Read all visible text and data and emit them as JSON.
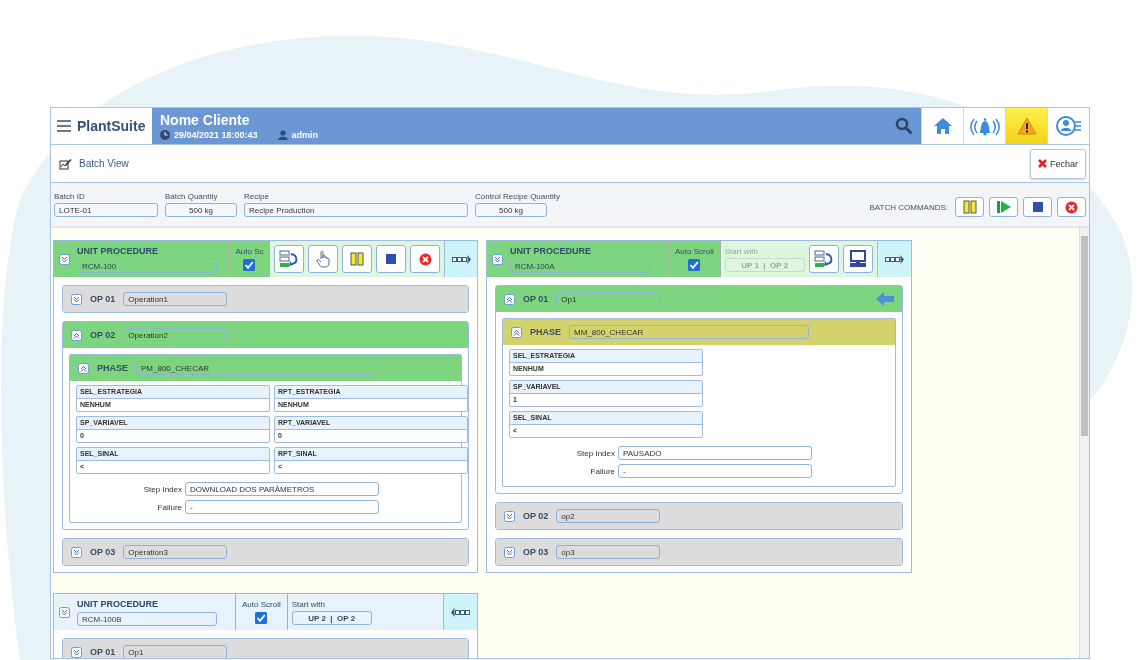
{
  "app": {
    "brand": "PlantSuite",
    "client": "Nome Cliente",
    "datetime": "29/04/2021 18:00:43",
    "user": "admin"
  },
  "header_tiles": [
    {
      "kind": "home",
      "alert": false
    },
    {
      "kind": "alarms",
      "alert": false
    },
    {
      "kind": "warning",
      "alert": true
    },
    {
      "kind": "user-menu",
      "alert": false
    }
  ],
  "page": {
    "title": "Batch View",
    "close_button": "Fechar"
  },
  "batch": {
    "fields": [
      {
        "label": "Batch ID",
        "value": "LOTE-01",
        "kind": "id"
      },
      {
        "label": "Batch Quantity",
        "value": "500 kg",
        "kind": "quantity"
      },
      {
        "label": "Recipe",
        "value": "Recipe Production",
        "kind": "name"
      },
      {
        "label": "Control Recipe Quantity",
        "value": "500 kg",
        "kind": "quantity"
      }
    ],
    "commands_label": "BATCH COMMANDS:",
    "commands": [
      {
        "kind": "pause"
      },
      {
        "kind": "start"
      },
      {
        "kind": "stop"
      },
      {
        "kind": "abort"
      }
    ]
  },
  "units": [
    {
      "active": true,
      "label": "UNIT PROCEDURE",
      "name": "RCM-100",
      "auto_scroll": {
        "label": "Auto Sc",
        "checked": true
      },
      "commands": [
        {
          "kind": "resume"
        },
        {
          "kind": "manual"
        },
        {
          "kind": "pause"
        },
        {
          "kind": "stop"
        },
        {
          "kind": "abort"
        }
      ],
      "nav_back": false,
      "operations": [
        {
          "code": "OP 01",
          "name": "Operation1",
          "active": false,
          "expanded": false,
          "current": false
        },
        {
          "code": "OP 02",
          "name": "Operation2",
          "active": true,
          "expanded": true,
          "current": false,
          "phases": [
            {
              "label": "PHASE",
              "name": "PM_800_CHECAR",
              "paused": false,
              "expanded": true,
              "parameter_rows": [
                [
                  {
                    "name": "SEL_ESTRATEGIA",
                    "value": "NENHUM"
                  },
                  {
                    "name": "RPT_ESTRATEGIA",
                    "value": "NENHUM"
                  }
                ],
                [
                  {
                    "name": "SP_VARIAVEL",
                    "value": "0"
                  },
                  {
                    "name": "RPT_VARIAVEL",
                    "value": "0"
                  }
                ],
                [
                  {
                    "name": "SEL_SINAL",
                    "value": "<"
                  },
                  {
                    "name": "RPT_SINAL",
                    "value": "<"
                  }
                ]
              ],
              "step_index": {
                "label": "Step Index",
                "value": "DOWNLOAD DOS PARÂMETROS"
              },
              "failure": {
                "label": "Failure",
                "value": "-"
              }
            }
          ]
        },
        {
          "code": "OP 03",
          "name": "Operation3",
          "active": false,
          "expanded": false,
          "current": false
        }
      ]
    },
    {
      "active": true,
      "label": "UNIT PROCEDURE",
      "name": "RCM-100A",
      "auto_scroll": {
        "label": "Auto Scroll",
        "checked": true
      },
      "start_with": {
        "label": "Start with",
        "value": "UP 1  |  OP 2",
        "disabled": true
      },
      "commands": [
        {
          "kind": "resume"
        },
        {
          "kind": "computer"
        }
      ],
      "nav_back": false,
      "operations": [
        {
          "code": "OP 01",
          "name": "Op1",
          "active": true,
          "expanded": true,
          "current": true,
          "phases": [
            {
              "label": "PHASE",
              "name": "MM_800_CHECAR",
              "paused": true,
              "expanded": true,
              "parameter_rows": [
                [
                  {
                    "name": "SEL_ESTRATEGIA",
                    "value": "NENHUM"
                  }
                ],
                [
                  {
                    "name": "SP_VARIAVEL",
                    "value": "1"
                  }
                ],
                [
                  {
                    "name": "SEL_SINAL",
                    "value": "<"
                  }
                ]
              ],
              "step_index": {
                "label": "Step Index",
                "value": "PAUSADO"
              },
              "failure": {
                "label": "Failure",
                "value": "-"
              }
            }
          ]
        },
        {
          "code": "OP 02",
          "name": "op2",
          "active": false,
          "expanded": false,
          "current": false
        },
        {
          "code": "OP 03",
          "name": "op3",
          "active": false,
          "expanded": false,
          "current": false
        }
      ]
    },
    {
      "active": false,
      "label": "UNIT PROCEDURE",
      "name": "RCM-100B",
      "auto_scroll": {
        "label": "Auto Scroll",
        "checked": true
      },
      "start_with": {
        "label": "Start with",
        "value": "UP 2  |  OP 2",
        "disabled": false
      },
      "nav_back": true,
      "operations": [
        {
          "code": "OP 01",
          "name": "Op1",
          "active": false,
          "expanded": false,
          "current": false
        }
      ]
    }
  ]
}
